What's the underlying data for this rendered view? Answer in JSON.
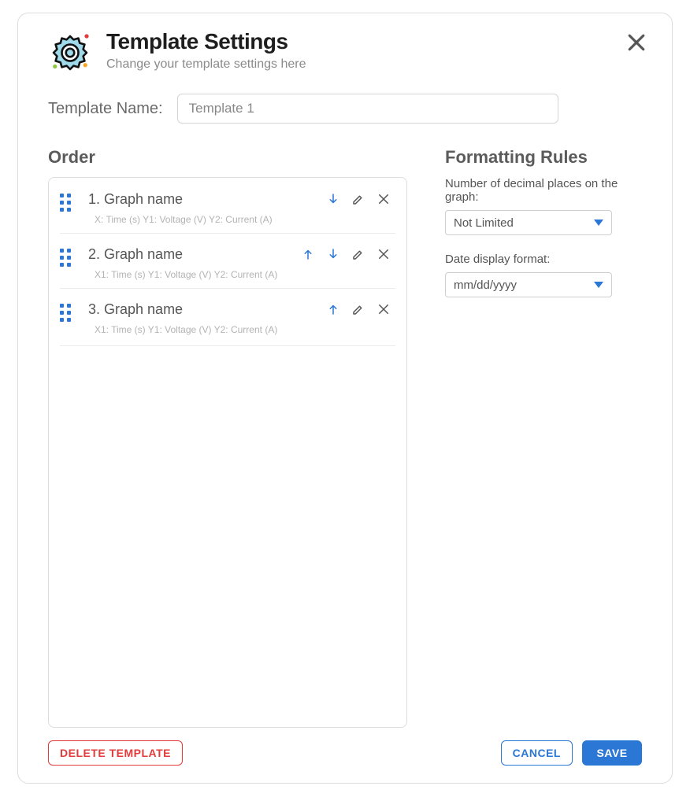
{
  "header": {
    "title": "Template Settings",
    "subtitle": "Change your template settings here"
  },
  "template_name": {
    "label": "Template Name:",
    "value": "Template 1"
  },
  "order": {
    "title": "Order",
    "items": [
      {
        "title": "1. Graph name",
        "axes": "X: Time (s)  Y1: Voltage (V)  Y2: Current (A)",
        "up": false,
        "down": true
      },
      {
        "title": "2. Graph name",
        "axes": "X1: Time (s)  Y1: Voltage (V)  Y2: Current (A)",
        "up": true,
        "down": true
      },
      {
        "title": "3. Graph name",
        "axes": "X1: Time (s)  Y1: Voltage (V)  Y2: Current (A)",
        "up": true,
        "down": false
      }
    ]
  },
  "formatting": {
    "title": "Formatting Rules",
    "decimal_label": "Number of decimal places on the graph:",
    "decimal_value": "Not Limited",
    "date_label": "Date display format:",
    "date_value": "mm/dd/yyyy"
  },
  "footer": {
    "delete_label": "DELETE TEMPLATE",
    "cancel_label": "CANCEL",
    "save_label": "SAVE"
  }
}
